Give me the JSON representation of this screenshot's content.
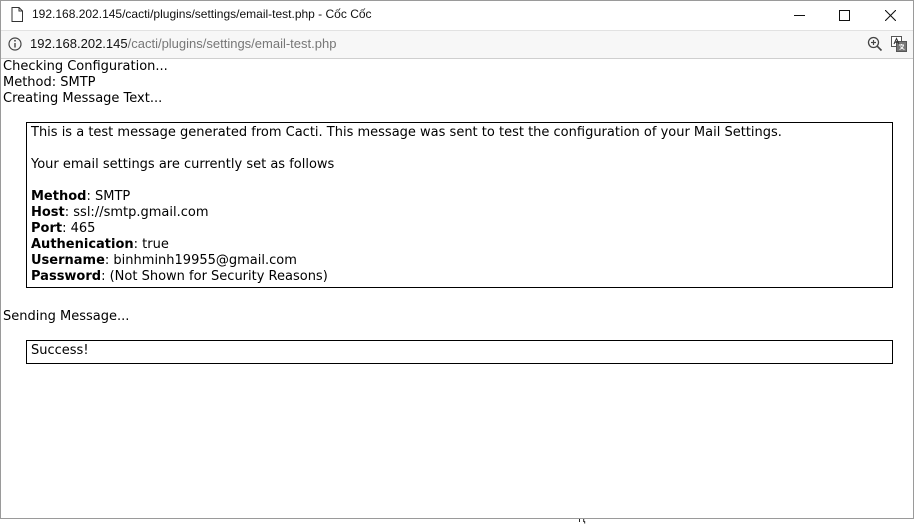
{
  "window": {
    "title": "192.168.202.145/cacti/plugins/settings/email-test.php - Cốc Cốc"
  },
  "address": {
    "host": "192.168.202.145",
    "path": "/cacti/plugins/settings/email-test.php"
  },
  "log": {
    "line1": "Checking Configuration...",
    "line2": "Method: SMTP",
    "line3": "Creating Message Text...",
    "line4": "Sending Message..."
  },
  "message": {
    "intro": "This is a test message generated from Cacti. This message was sent to test the configuration of your Mail Settings.",
    "settings_heading": "Your email settings are currently set as follows",
    "fields": [
      {
        "label": "Method",
        "value": ": SMTP"
      },
      {
        "label": "Host",
        "value": ": ssl://smtp.gmail.com"
      },
      {
        "label": "Port",
        "value": ": 465"
      },
      {
        "label": "Authenication",
        "value": ": true"
      },
      {
        "label": "Username",
        "value": ": binhminh19955@gmail.com"
      },
      {
        "label": "Password",
        "value": ": (Not Shown for Security Reasons)"
      }
    ]
  },
  "result": {
    "text": "Success!"
  },
  "background": {
    "bottom_fragment": "ԥ"
  },
  "icons": {
    "page": "document-icon",
    "info": "info-icon",
    "minimize": "minimize-icon",
    "maximize": "maximize-icon",
    "close": "close-icon",
    "zoom": "zoom-in-icon",
    "translate": "translate-icon"
  }
}
